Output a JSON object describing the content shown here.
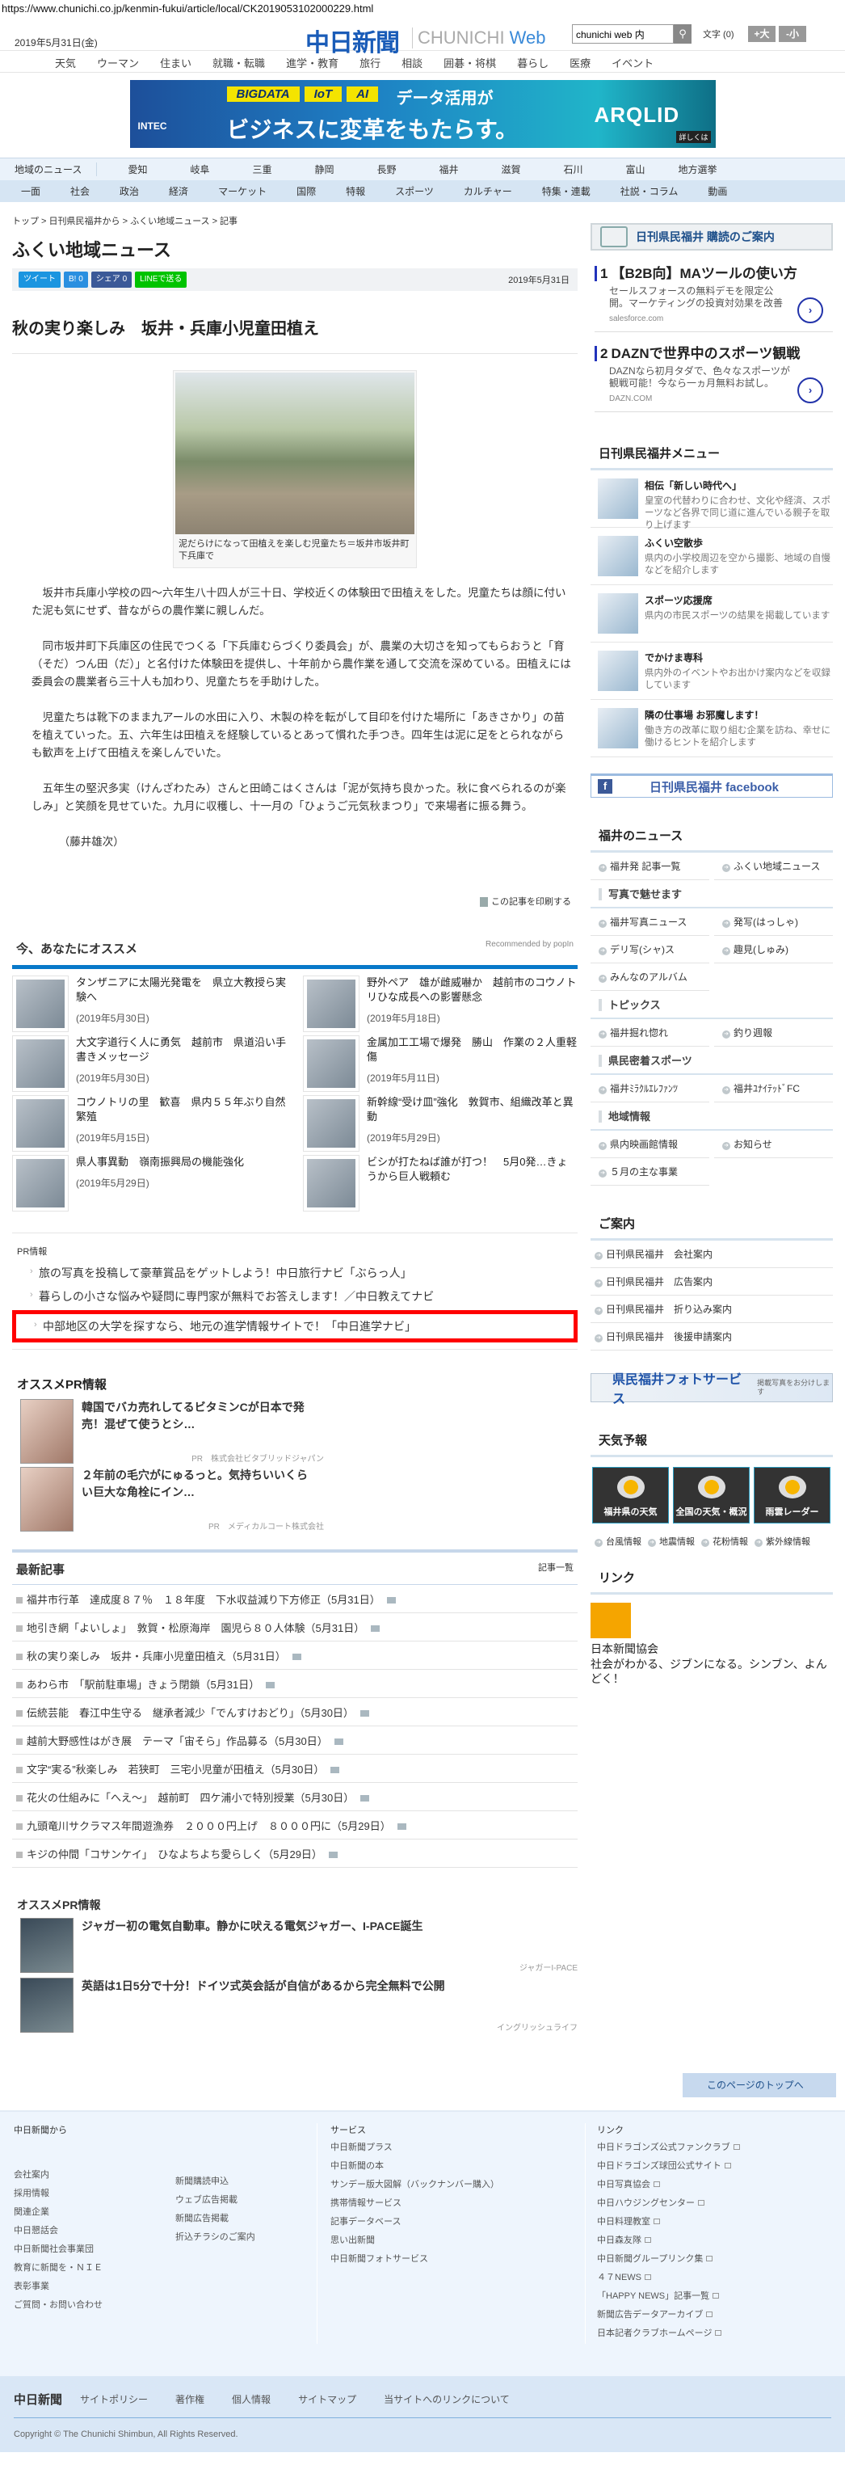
{
  "browser": {
    "url": "https://www.chunichi.co.jp/kenmin-fukui/article/local/CK2019053102000229.html"
  },
  "header": {
    "date": "2019年5月31日(金)",
    "logo": "中日新聞",
    "logo_sub_a": "CHUNICHI ",
    "logo_sub_b": "Web",
    "search_value": "chunichi web 内",
    "font_size_label": "文字 (0)",
    "font_larger": "+大",
    "font_smaller": "-小"
  },
  "top_nav": [
    "天気",
    "ウーマン",
    "住まい",
    "就職・転職",
    "進学・教育",
    "旅行",
    "相談",
    "囲碁・将棋",
    "暮らし",
    "医療",
    "イベント"
  ],
  "ad_banner": {
    "tags": [
      "BIGDATA",
      "IoT",
      "AI"
    ],
    "line1": "データ活用が",
    "line2": "ビジネスに変革をもたらす。",
    "brand": "INTEC",
    "product": "ARQLID",
    "details": "詳しくは"
  },
  "regional_nav": {
    "label": "地域のニュース",
    "items": [
      "愛知",
      "岐阜",
      "三重",
      "静岡",
      "長野",
      "福井",
      "滋賀",
      "石川",
      "富山",
      "地方選挙"
    ]
  },
  "section_nav": [
    "一面",
    "社会",
    "政治",
    "経済",
    "マーケット",
    "国際",
    "特報",
    "スポーツ",
    "カルチャー",
    "特集・連載",
    "社説・コラム",
    "動画"
  ],
  "breadcrumb": "トップ > 日刊県民福井から > ふくい地域ニュース > 記事",
  "page_title": "ふくい地域ニュース",
  "share": {
    "tweet": "ツイート",
    "hatena": "B! 0",
    "facebook": "シェア 0",
    "line": "LINEで送る",
    "date": "2019年5月31日"
  },
  "article": {
    "title": "秋の実り楽しみ　坂井・兵庫小児童田植え",
    "caption": "泥だらけになって田植えを楽しむ児童たち＝坂井市坂井町下兵庫で",
    "paragraphs": [
      "坂井市兵庫小学校の四～六年生八十四人が三十日、学校近くの体験田で田植えをした。児童たちは顔に付いた泥も気にせず、昔ながらの農作業に親しんだ。",
      "同市坂井町下兵庫区の住民でつくる「下兵庫むらづくり委員会」が、農業の大切さを知ってもらおうと「育（そだ）つん田（だ）」と名付けた体験田を提供し、十年前から農作業を通して交流を深めている。田植えには委員会の農業者ら三十人も加わり、児童たちを手助けした。",
      "児童たちは靴下のまま九アールの水田に入り、木製の枠を転がして目印を付けた場所に「あきさかり」の苗を植えていった。五、六年生は田植えを経験しているとあって慣れた手つき。四年生は泥に足をとられながらも歓声を上げて田植えを楽しんでいた。",
      "五年生の堅沢多実（けんざわたみ）さんと田崎こはくさんは「泥が気持ち良かった。秋に食べられるのが楽しみ」と笑顔を見せていた。九月に収穫し、十一月の「ひょうご元気秋まつり」で来場者に振る舞う。"
    ],
    "byline": "（藤井雄次）",
    "print": "この記事を印刷する"
  },
  "recommend": {
    "title": "今、あなたにオススメ",
    "powered": "Recommended by popIn",
    "items": [
      {
        "title": "タンザニアに太陽光発電を　県立大教授ら実験へ",
        "date": "(2019年5月30日)"
      },
      {
        "title": "野外ペア　雄が雌威嚇か　越前市のコウノトリひな成長への影響懸念",
        "date": "(2019年5月18日)"
      },
      {
        "title": "大文字道行く人に勇気　越前市　県道沿い手書きメッセージ",
        "date": "(2019年5月30日)"
      },
      {
        "title": "金属加工工場で爆発　勝山　作業の２人重軽傷",
        "date": "(2019年5月11日)"
      },
      {
        "title": "コウノトリの里　歓喜　県内５５年ぶり自然繁殖",
        "date": "(2019年5月15日)"
      },
      {
        "title": "新幹線“受け皿”強化　敦賀市、組織改革と異動",
        "date": "(2019年5月29日)"
      },
      {
        "title": "県人事異動　嶺南振興局の機能強化",
        "date": "(2019年5月29日)"
      },
      {
        "title": "ビシが打たねば誰が打つ！　5月0発…きょうから巨人戦頼む",
        "date": ""
      }
    ]
  },
  "pr_info": {
    "label": "PR情報",
    "items": [
      "旅の写真を投稿して豪華賞品をゲットしよう！中日旅行ナビ「ぶらっ人」",
      "暮らしの小さな悩みや疑問に専門家が無料でお答えします！／中日教えてナビ",
      "中部地区の大学を探すなら、地元の進学情報サイトで！「中日進学ナビ」"
    ]
  },
  "pr_recommend": {
    "title": "オススメPR情報",
    "items": [
      {
        "title": "韓国でバカ売れしてるビタミンCが日本で発売！混ぜて使うとシ…",
        "sponsor": "PR　株式会社ビタブリッドジャパン"
      },
      {
        "title": "２年前の毛穴がにゅるっと。気持ちいいくらい巨大な角栓にイン…",
        "sponsor": "PR　メディカルコート株式会社"
      }
    ]
  },
  "latest": {
    "title": "最新記事",
    "more": "記事一覧",
    "items": [
      {
        "t": "福井市行革　達成度８７％　１８年度　下水収益減り下方修正（5月31日）"
      },
      {
        "t": "地引き網「よいしょ」　敦賀・松原海岸　園児ら８０人体験（5月31日）"
      },
      {
        "t": "秋の実り楽しみ　坂井・兵庫小児童田植え（5月31日）"
      },
      {
        "t": "あわら市　「駅前駐車場」きょう閉鎖（5月31日）"
      },
      {
        "t": "伝統芸能　春江中生守る　継承者減少「でんすけおどり」（5月30日）"
      },
      {
        "t": "越前大野感性はがき展　テーマ「宙そら」作品募る（5月30日）"
      },
      {
        "t": "文字“実る”秋楽しみ　若狭町　三宅小児童が田植え（5月30日）"
      },
      {
        "t": "花火の仕組みに「へえ～」　越前町　四ケ浦小で特別授業（5月30日）"
      },
      {
        "t": "九頭竜川サクラマス年間遊漁券　２０００円上げ　８０００円に（5月29日）"
      },
      {
        "t": "キジの仲間「コサンケイ」　ひなよちよち愛らしく（5月29日）"
      }
    ]
  },
  "pr_recommend2": {
    "title": "オススメPR情報",
    "items": [
      {
        "title": "ジャガー初の電気自動車。静かに吠える電気ジャガー、I-PACE誕生",
        "sponsor": "ジャガーI-PACE"
      },
      {
        "title": "英語は1日5分で十分！ドイツ式英会話が自信があるから完全無料で公開",
        "sponsor": "イングリッシュライフ"
      }
    ]
  },
  "page_top": "このページのトップへ",
  "sidebar": {
    "subscribe": "日刊県民福井 購読のご案内",
    "ads": [
      {
        "num": "1",
        "title": "【B2B向】MAツールの使い方",
        "desc": "セールスフォースの無料デモを限定公開。マーケティングの投資対効果を改善",
        "domain": "salesforce.com"
      },
      {
        "num": "2",
        "title": "DAZNで世界中のスポーツ観戦",
        "desc": "DAZNなら初月タダで、色々なスポーツが観戦可能！今なら一ヵ月無料お試し。",
        "domain": "DAZN.COM"
      }
    ],
    "menu_title": "日刊県民福井メニュー",
    "menu": [
      {
        "title": "相伝「新しい時代へ」",
        "desc": "皇室の代替わりに合わせ、文化や経済、スポーツなど各界で同じ道に進んでいる親子を取り上げます"
      },
      {
        "title": "ふくい空散歩",
        "desc": "県内の小学校周辺を空から撮影、地域の自慢などを紹介します"
      },
      {
        "title": "スポーツ応援席",
        "desc": "県内の市民スポーツの結果を掲載しています"
      },
      {
        "title": "でかけま専科",
        "desc": "県内外のイベントやお出かけ案内などを収録しています"
      },
      {
        "title": "隣の仕事場 お邪魔します！",
        "desc": "働き方の改革に取り組む企業を訪ね、幸せに働けるヒントを紹介します"
      }
    ],
    "facebook": "日刊県民福井 facebook",
    "news_title": "福井のニュース",
    "news_links": [
      "福井発 記事一覧",
      "ふくい地域ニュース"
    ],
    "photo_title": "写真で魅せます",
    "photo_links": [
      "福井写真ニュース",
      "発写(はっしゃ)",
      "デリ写(シャ)ス",
      "趣見(しゅみ)",
      "みんなのアルバム"
    ],
    "topics_title": "トピックス",
    "topics_links": [
      "福井掘れ惚れ",
      "釣り週報"
    ],
    "sports_title": "県民密着スポーツ",
    "sports_links": [
      "福井ﾐﾗｸﾙｴﾚﾌｧﾝﾂ",
      "福井ﾕﾅｲﾃｯﾄﾞFC"
    ],
    "region_title": "地域情報",
    "region_links": [
      "県内映画館情報",
      "お知らせ",
      "５月の主な事業"
    ],
    "guide_title": "ご案内",
    "guide_links": [
      "日刊県民福井　会社案内",
      "日刊県民福井　広告案内",
      "日刊県民福井　折り込み案内",
      "日刊県民福井　後援申請案内"
    ],
    "photo_service": "県民福井フォトサービス",
    "photo_service_sub": "掲載写真をお分けします",
    "weather_title": "天気予報",
    "weather_tiles": [
      "福井県の天気",
      "全国の天気・概況",
      "雨雲レーダー"
    ],
    "weather_links": [
      "台風情報",
      "地震情報",
      "花粉情報",
      "紫外線情報"
    ],
    "link_title": "リンク",
    "link_name": "日本新聞協会",
    "link_desc": "社会がわかる、ジブンになる。シンブン、よんどく！"
  },
  "footer": {
    "col1_title": "中日新聞から",
    "col1a": [
      "会社案内",
      "採用情報",
      "関連企業",
      "中日懇話会",
      "中日新聞社会事業団",
      "教育に新聞を・ＮＩＥ",
      "表彰事業",
      "ご質問・お問い合わせ"
    ],
    "col1b": [
      "新聞購読申込",
      "ウェブ広告掲載",
      "新聞広告掲載",
      "折込チラシのご案内"
    ],
    "col2_title": "サービス",
    "col2": [
      "中日新聞プラス",
      "中日新聞の本",
      "サンデー版大図解（バックナンバー購入）",
      "携帯情報サービス",
      "記事データベース",
      "思い出新聞",
      "中日新聞フォトサービス"
    ],
    "col3_title": "リンク",
    "col3": [
      "中日ドラゴンズ公式ファンクラブ",
      "中日ドラゴンズ球団公式サイト",
      "中日写真協会",
      "中日ハウジングセンター",
      "中日料理教室",
      "中日森友隊",
      "中日新聞グループリンク集",
      "４７NEWS",
      "「HAPPY NEWS」記事一覧",
      "新聞広告データアーカイブ",
      "日本記者クラブホームページ"
    ],
    "logo": "中日新聞",
    "bottom_links": [
      "サイトポリシー",
      "著作権",
      "個人情報",
      "サイトマップ",
      "当サイトへのリンクについて"
    ],
    "copyright": "Copyright © The Chunichi Shimbun, All Rights Reserved."
  },
  "colors": {
    "brand": "#1a5cb8",
    "accent_bar": "#0879c9",
    "highlight": "#ff0000"
  }
}
